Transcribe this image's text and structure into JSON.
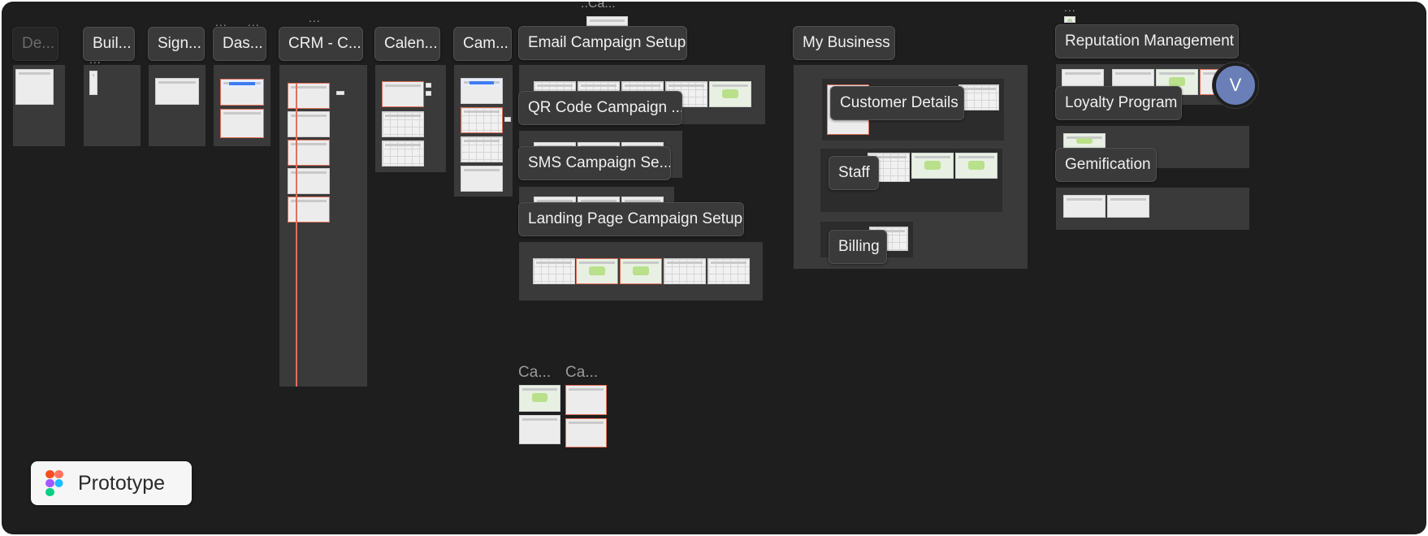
{
  "canvas": {
    "background": "#1e1e1e"
  },
  "sections": {
    "design_system": "De...",
    "build": "Buil...",
    "sign": "Sign...",
    "dashboard": "Das...",
    "crm": "CRM - C...",
    "calendar": "Calen...",
    "campaigns": "Cam...",
    "email_campaign": "Email Campaign Setup",
    "qr_campaign": "QR Code Campaign ...",
    "sms_campaign": "SMS Campaign Se...",
    "landing_campaign": "Landing Page Campaign Setup",
    "my_business": "My Business",
    "customer_details": "Customer Details",
    "staff": "Staff",
    "billing": "Billing",
    "reputation": "Reputation Management",
    "loyalty": "Loyalty Program",
    "gamification": "Gemification"
  },
  "small_labels": {
    "ca1": "Ca...",
    "ca2": "Ca...",
    "top_ca": "..Ca..."
  },
  "dots": "...",
  "prototype": {
    "label": "Prototype"
  },
  "avatar": {
    "initial": "V",
    "color": "#6a7fb8"
  },
  "colors": {
    "accent_red": "#e0705a",
    "accent_blue": "#3f7cf0",
    "accent_green": "#b9e08a"
  }
}
